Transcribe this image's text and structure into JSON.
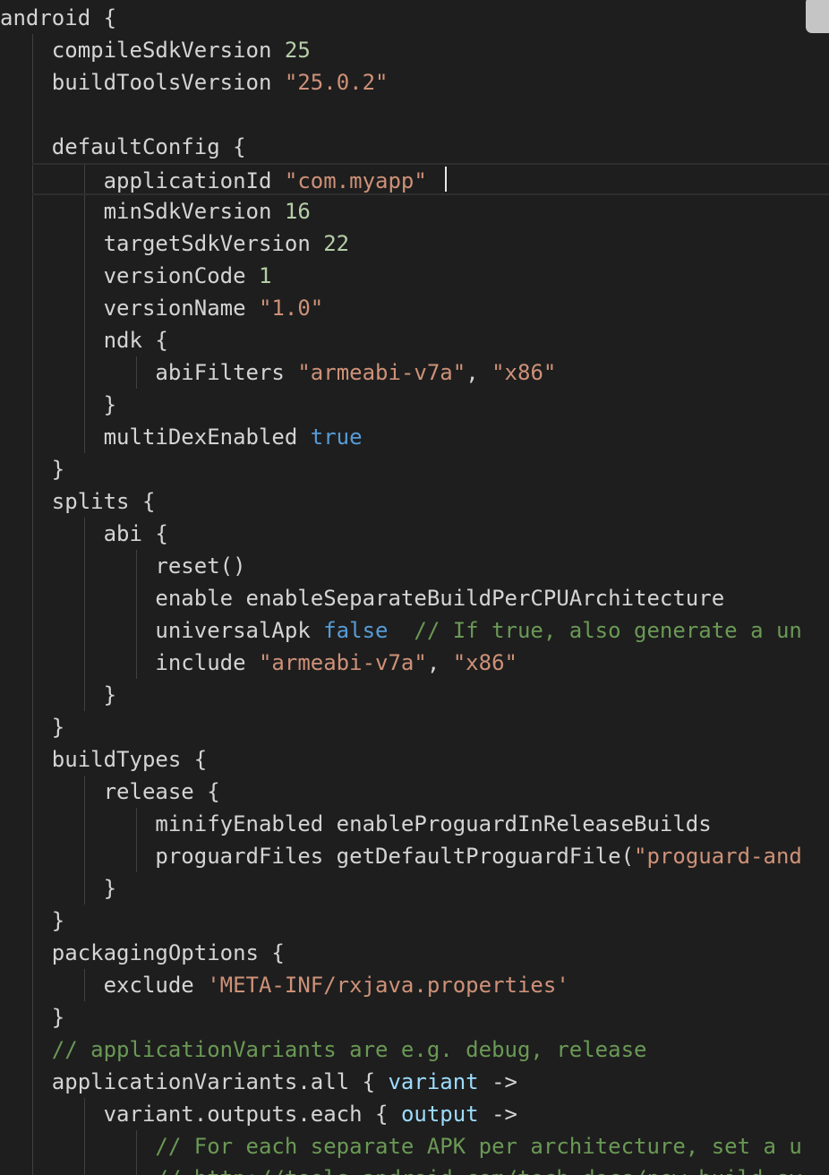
{
  "editor": {
    "language": "groovy",
    "colors": {
      "background": "#1e1e1e",
      "text": "#d4d4d4",
      "keyword": "#569cd6",
      "number": "#b5cea8",
      "string": "#ce9178",
      "comment": "#6a9955",
      "parameter": "#9cdcfe"
    },
    "lines": [
      [
        {
          "t": "plain",
          "v": "android {"
        }
      ],
      [
        {
          "t": "plain",
          "v": "    compileSdkVersion "
        },
        {
          "t": "num",
          "v": "25"
        }
      ],
      [
        {
          "t": "plain",
          "v": "    buildToolsVersion "
        },
        {
          "t": "str",
          "v": "\"25.0.2\""
        }
      ],
      [],
      [
        {
          "t": "plain",
          "v": "    defaultConfig {"
        }
      ],
      [
        {
          "t": "plain",
          "v": "        applicationId "
        },
        {
          "t": "str",
          "v": "\"com.myapp\""
        }
      ],
      [
        {
          "t": "plain",
          "v": "        minSdkVersion "
        },
        {
          "t": "num",
          "v": "16"
        }
      ],
      [
        {
          "t": "plain",
          "v": "        targetSdkVersion "
        },
        {
          "t": "num",
          "v": "22"
        }
      ],
      [
        {
          "t": "plain",
          "v": "        versionCode "
        },
        {
          "t": "num",
          "v": "1"
        }
      ],
      [
        {
          "t": "plain",
          "v": "        versionName "
        },
        {
          "t": "str",
          "v": "\"1.0\""
        }
      ],
      [
        {
          "t": "plain",
          "v": "        ndk {"
        }
      ],
      [
        {
          "t": "plain",
          "v": "            abiFilters "
        },
        {
          "t": "str",
          "v": "\"armeabi-v7a\""
        },
        {
          "t": "plain",
          "v": ", "
        },
        {
          "t": "str",
          "v": "\"x86\""
        }
      ],
      [
        {
          "t": "plain",
          "v": "        }"
        }
      ],
      [
        {
          "t": "plain",
          "v": "        multiDexEnabled "
        },
        {
          "t": "kw",
          "v": "true"
        }
      ],
      [
        {
          "t": "plain",
          "v": "    }"
        }
      ],
      [
        {
          "t": "plain",
          "v": "    splits {"
        }
      ],
      [
        {
          "t": "plain",
          "v": "        abi {"
        }
      ],
      [
        {
          "t": "plain",
          "v": "            reset()"
        }
      ],
      [
        {
          "t": "plain",
          "v": "            enable enableSeparateBuildPerCPUArchitecture"
        }
      ],
      [
        {
          "t": "plain",
          "v": "            universalApk "
        },
        {
          "t": "kw",
          "v": "false"
        },
        {
          "t": "plain",
          "v": "  "
        },
        {
          "t": "cmt",
          "v": "// If true, also generate a un"
        }
      ],
      [
        {
          "t": "plain",
          "v": "            include "
        },
        {
          "t": "str",
          "v": "\"armeabi-v7a\""
        },
        {
          "t": "plain",
          "v": ", "
        },
        {
          "t": "str",
          "v": "\"x86\""
        }
      ],
      [
        {
          "t": "plain",
          "v": "        }"
        }
      ],
      [
        {
          "t": "plain",
          "v": "    }"
        }
      ],
      [
        {
          "t": "plain",
          "v": "    buildTypes {"
        }
      ],
      [
        {
          "t": "plain",
          "v": "        release {"
        }
      ],
      [
        {
          "t": "plain",
          "v": "            minifyEnabled enableProguardInReleaseBuilds"
        }
      ],
      [
        {
          "t": "plain",
          "v": "            proguardFiles getDefaultProguardFile("
        },
        {
          "t": "str",
          "v": "\"proguard-and"
        }
      ],
      [
        {
          "t": "plain",
          "v": "        }"
        }
      ],
      [
        {
          "t": "plain",
          "v": "    }"
        }
      ],
      [
        {
          "t": "plain",
          "v": "    packagingOptions {"
        }
      ],
      [
        {
          "t": "plain",
          "v": "        exclude "
        },
        {
          "t": "str",
          "v": "'META-INF/rxjava.properties'"
        }
      ],
      [
        {
          "t": "plain",
          "v": "    }"
        }
      ],
      [
        {
          "t": "plain",
          "v": "    "
        },
        {
          "t": "cmt",
          "v": "// applicationVariants are e.g. debug, release"
        }
      ],
      [
        {
          "t": "plain",
          "v": "    applicationVariants.all { "
        },
        {
          "t": "param",
          "v": "variant"
        },
        {
          "t": "plain",
          "v": " ->"
        }
      ],
      [
        {
          "t": "plain",
          "v": "        variant.outputs.each { "
        },
        {
          "t": "param",
          "v": "output"
        },
        {
          "t": "plain",
          "v": " ->"
        }
      ],
      [
        {
          "t": "plain",
          "v": "            "
        },
        {
          "t": "cmt",
          "v": "// For each separate APK per architecture, set a u"
        }
      ],
      [
        {
          "t": "plain",
          "v": "            "
        },
        {
          "t": "cmt",
          "v": "// http://tools.android.com/tech-docs/new-build-sy"
        }
      ]
    ]
  }
}
